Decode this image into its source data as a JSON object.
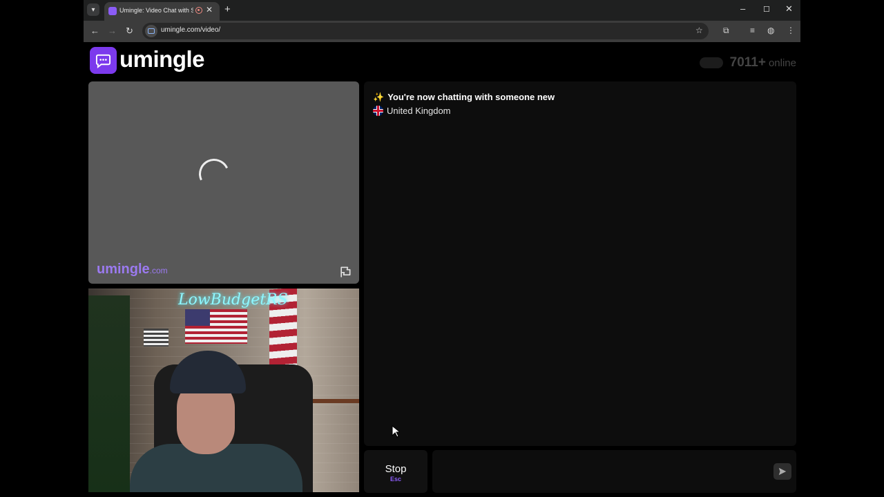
{
  "browser": {
    "tab": {
      "title": "Umingle: Video Chat with S",
      "close_glyph": "✕"
    },
    "new_tab_glyph": "+",
    "window_controls": {
      "minimize": "–",
      "maximize": "☐",
      "close": "✕"
    },
    "toolbar": {
      "back": "←",
      "forward": "→",
      "reload": "↻",
      "url": "umingle.com/video/",
      "bookmark": "☆",
      "extensions": "⧉",
      "menu": "⋮"
    }
  },
  "header": {
    "logo_text": "umingle",
    "online_count": "7011+",
    "online_label": "online"
  },
  "stranger_video": {
    "watermark_main": "umingle",
    "watermark_suffix": ".com"
  },
  "self_video": {
    "neon_sign": "LowBudgetRS"
  },
  "chat": {
    "status_message": "You're now chatting with someone new",
    "status_icon": "✨",
    "country": "United Kingdom"
  },
  "controls": {
    "stop_label": "Stop",
    "stop_hint": "Esc",
    "message_placeholder": "",
    "send_icon": "send-icon"
  },
  "colors": {
    "brand": "#7c3aed",
    "watermark": "#9b7af0",
    "accent_hint": "#8b5cf6"
  }
}
